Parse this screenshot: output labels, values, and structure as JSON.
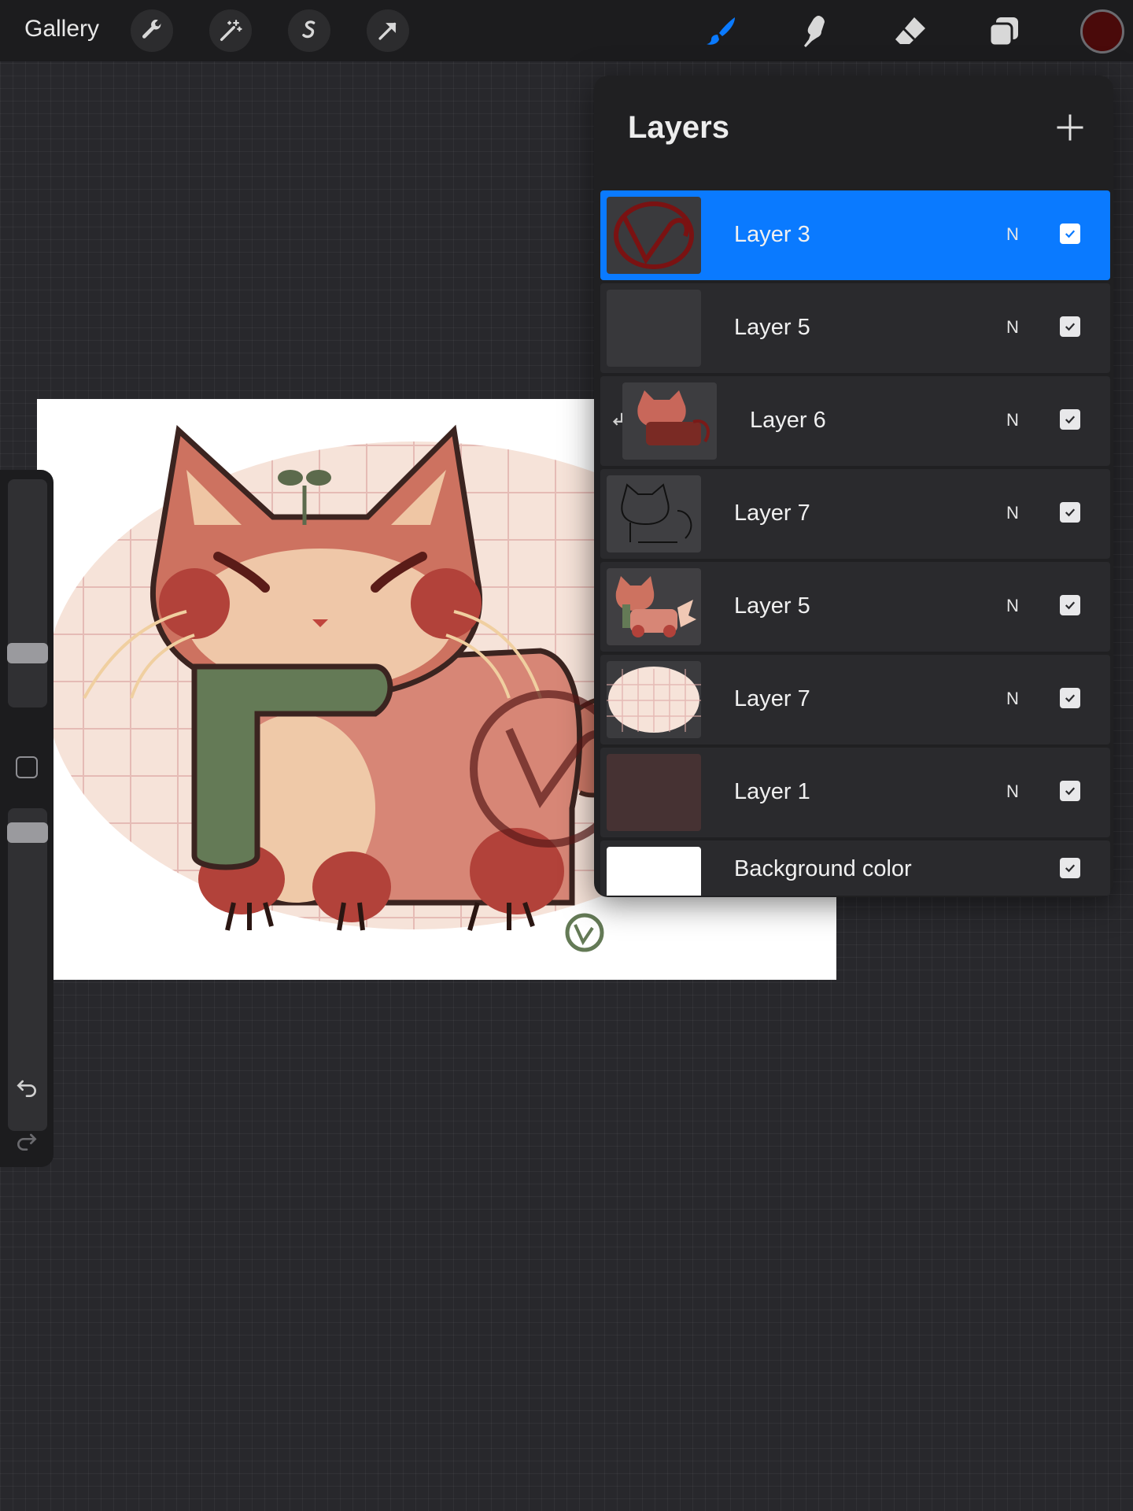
{
  "toolbar": {
    "gallery_label": "Gallery",
    "left_tools": [
      "wrench-icon",
      "magic-wand-icon",
      "selection-s-icon",
      "transform-arrow-icon"
    ],
    "right_tools": [
      "brush-icon",
      "smudge-icon",
      "eraser-icon",
      "layers-icon"
    ],
    "active_tool": "brush-icon",
    "active_color": "#4a0a0a",
    "accent_color": "#0a7aff"
  },
  "layers": {
    "title": "Layers",
    "items": [
      {
        "name": "Layer 3",
        "blend": "N",
        "visible": true,
        "selected": true
      },
      {
        "name": "Layer 5",
        "blend": "N",
        "visible": true,
        "selected": false
      },
      {
        "name": "Layer 6",
        "blend": "N",
        "visible": true,
        "selected": false,
        "clipped": true
      },
      {
        "name": "Layer 7",
        "blend": "N",
        "visible": true,
        "selected": false
      },
      {
        "name": "Layer 5",
        "blend": "N",
        "visible": true,
        "selected": false
      },
      {
        "name": "Layer 7",
        "blend": "N",
        "visible": true,
        "selected": false
      },
      {
        "name": "Layer 1",
        "blend": "N",
        "visible": true,
        "selected": false
      },
      {
        "name": "Background color",
        "blend": "",
        "visible": true,
        "selected": false
      }
    ]
  }
}
